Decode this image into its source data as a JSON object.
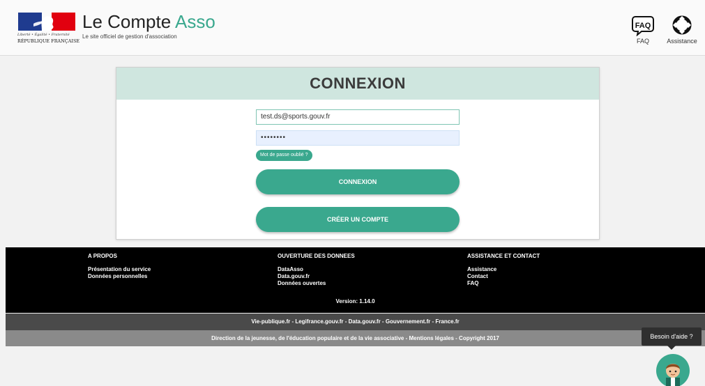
{
  "header": {
    "devise": "Liberté • Égalité • Fraternité",
    "republique": "RÉPUBLIQUE FRANÇAISE",
    "title_main": "Le Compte ",
    "title_accent": "Asso",
    "subtitle": "Le site officiel de gestion d'association",
    "faq_icon_text": "FAQ",
    "faq_label": "FAQ",
    "assistance_label": "Assistance"
  },
  "login": {
    "title": "CONNEXION",
    "email_value": "test.ds@sports.gouv.fr",
    "password_mask": "••••••••",
    "forgot_label": "Mot de passe oublié ?",
    "login_button": "CONNEXION",
    "create_button": "CRÉER UN COMPTE"
  },
  "footer": {
    "columns": [
      {
        "heading": "A PROPOS",
        "links": [
          "Présentation du service",
          "Données personnelles"
        ]
      },
      {
        "heading": "OUVERTURE DES DONNEES",
        "links": [
          "DataAsso",
          "Data.gouv.fr",
          "Données ouvertes"
        ]
      },
      {
        "heading": "ASSISTANCE ET CONTACT",
        "links": [
          "Assistance",
          "Contact",
          "FAQ"
        ]
      }
    ],
    "version": "Version: 1.14.0",
    "links_bar": "Vie-publique.fr - Legifrance.gouv.fr - Data.gouv.fr - Gouvernement.fr - France.fr",
    "credit_bar": "Direction de la jeunesse, de l'éducation populaire et de la vie associative - Mentions légales - Copyright 2017"
  },
  "help": {
    "bubble": "Besoin d'aide ?"
  },
  "colors": {
    "accent": "#3aa88e",
    "card_header": "#cfe6df",
    "flag_blue": "#1f3b8f",
    "flag_red": "#e1000f"
  },
  "icons": [
    "marianne-logo",
    "faq-icon",
    "lifebuoy-icon",
    "avatar-icon"
  ]
}
